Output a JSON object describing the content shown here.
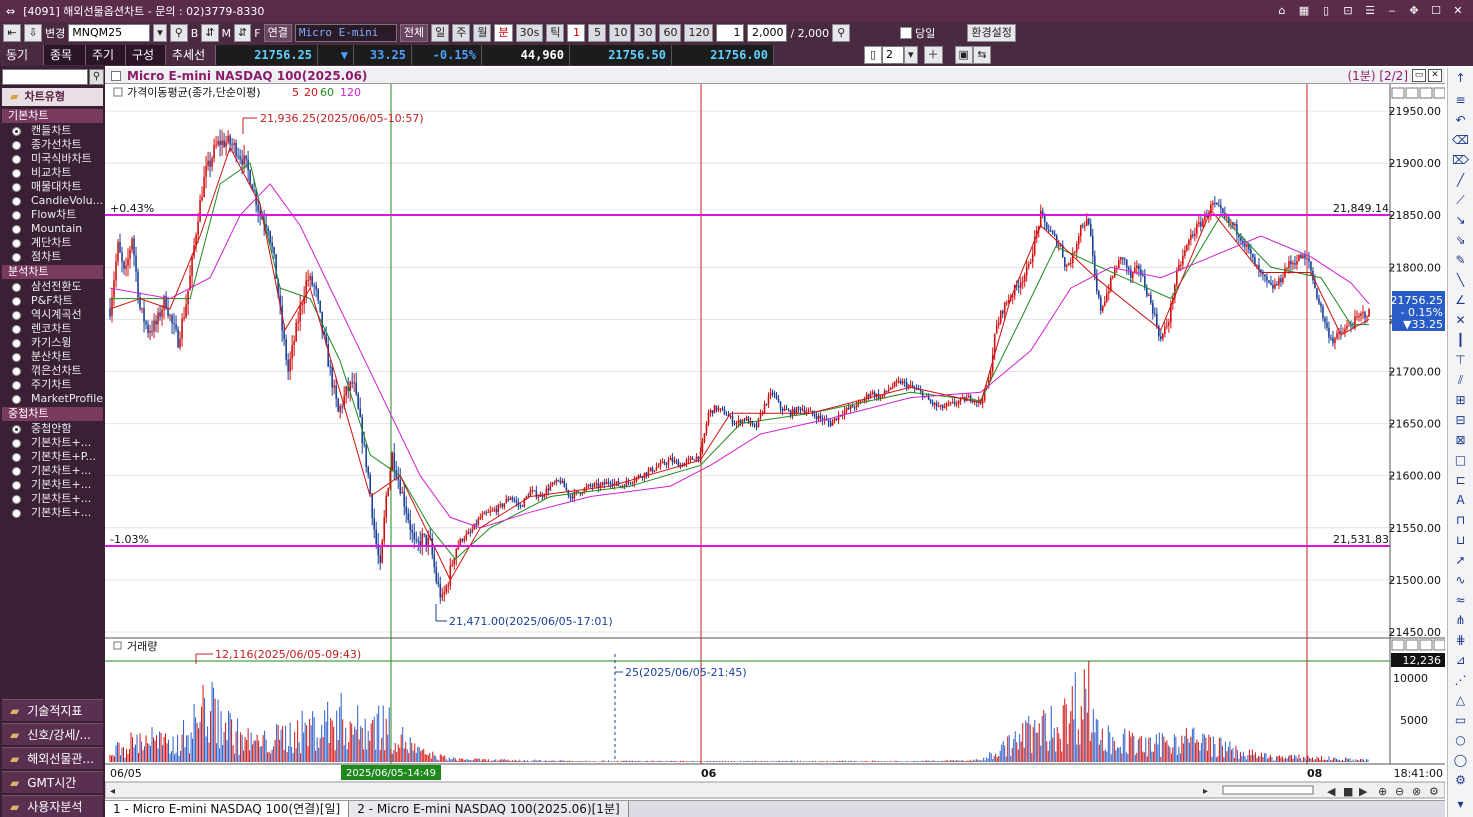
{
  "window": {
    "title": "[4091] 해외선물옵션차트 - 문의 : 02)3779-8330",
    "controls": [
      "⌂",
      "▦",
      "▯",
      "⊡",
      "☰",
      "‒",
      "✥",
      "☐",
      "✕"
    ]
  },
  "toolbar1": {
    "change_label": "변경",
    "symbol_value": "MNQM25",
    "btn_b": "B",
    "btn_m": "M",
    "btn_f": "F",
    "linked_label": "연결",
    "product_name": "Micro E-mini NAS",
    "all_label": "전체",
    "periods": [
      "일",
      "주",
      "월",
      "분",
      "30s",
      "틱"
    ],
    "minutes": [
      "1",
      "5",
      "10",
      "30",
      "60",
      "120"
    ],
    "step_value": "1",
    "count_value": "2,000",
    "count_total": "/ 2,000",
    "today_label": "당일",
    "settings_label": "환경설정"
  },
  "toolbar2": {
    "tabs": [
      "동기화",
      "종목",
      "주기",
      "구성",
      "추세선"
    ],
    "last_price": "21756.25",
    "change_arrow": "▼",
    "change": "33.25",
    "change_pct": "-0.15%",
    "volume": "44,960",
    "ask": "21756.50",
    "bid": "21756.00",
    "split_value": "2"
  },
  "left_panel": {
    "header": "차트유형",
    "sections": [
      {
        "title": "기본차트",
        "items": [
          "캔들차트",
          "종가선차트",
          "미국식바차트",
          "비교차트",
          "매물대차트",
          "CandleVolu...",
          "Flow차트",
          "Mountain",
          "계단차트",
          "점차트"
        ]
      },
      {
        "title": "분석차트",
        "items": [
          "삼선전환도",
          "P&F차트",
          "역시계곡선",
          "렌코차트",
          "카기스윙",
          "분산차트",
          "꺾은선차트",
          "주기차트",
          "MarketProfile"
        ]
      },
      {
        "title": "중첩차트",
        "items": [
          "중첩안함",
          "기본차트+...",
          "기본차트+P...",
          "기본차트+...",
          "기본차트+...",
          "기본차트+...",
          "기본차트+..."
        ]
      }
    ],
    "footer": [
      "기술적지표",
      "신호/강세/...",
      "해외선물관...",
      "GMT시간",
      "사용자분석"
    ]
  },
  "chart": {
    "title": "Micro E-mini NASDAQ 100(2025.06)",
    "period_info": "(1분) [2/2]",
    "ma_label": "가격이동평균(종가,단순이평)",
    "ma_periods": [
      "5",
      "20",
      "60",
      "120"
    ],
    "ma_colors": [
      "#d01010",
      "#1e8a1e",
      "#1a3f9a",
      "#d020d0"
    ],
    "high_label": "21,936.25(2025/06/05-10:57)",
    "low_label": "21,471.00(2025/06/05-17:01)",
    "upper_line": {
      "pct": "+0.43%",
      "value": "21,849.14"
    },
    "lower_line": {
      "pct": "-1.03%",
      "value": "21,531.83"
    },
    "price_ticks": [
      "21950.00",
      "21900.00",
      "21850.00",
      "21800.00",
      "21750.00",
      "21700.00",
      "21650.00",
      "21600.00",
      "21550.00",
      "21500.00",
      "21450.00"
    ],
    "last_box": {
      "price": "21756.25",
      "pct": "- 0.15%",
      "chg": "▼33.25"
    },
    "volume_title": "거래량",
    "volume_high_label": "12,116(2025/06/05-09:43)",
    "volume_low_label": "25(2025/06/05-21:45)",
    "volume_last": "12,236",
    "volume_ticks": [
      "10000",
      "5000"
    ],
    "x_labels": [
      "06/05",
      "06",
      "08",
      "18:41:00"
    ],
    "crosshair_time": "2025/06/05-14:49"
  },
  "chart_data": {
    "type": "candlestick",
    "title": "Micro E-mini NASDAQ 100(2025.06)",
    "interval": "1분",
    "ylim": [
      21440,
      21960
    ],
    "close_path": [
      [
        0,
        21760
      ],
      [
        8,
        21820
      ],
      [
        15,
        21790
      ],
      [
        22,
        21830
      ],
      [
        30,
        21760
      ],
      [
        38,
        21740
      ],
      [
        46,
        21745
      ],
      [
        55,
        21770
      ],
      [
        62,
        21745
      ],
      [
        68,
        21730
      ],
      [
        75,
        21760
      ],
      [
        80,
        21790
      ],
      [
        88,
        21850
      ],
      [
        95,
        21890
      ],
      [
        100,
        21900
      ],
      [
        105,
        21915
      ],
      [
        110,
        21920
      ],
      [
        118,
        21920
      ],
      [
        125,
        21915
      ],
      [
        135,
        21900
      ],
      [
        142,
        21880
      ],
      [
        150,
        21850
      ],
      [
        158,
        21840
      ],
      [
        165,
        21800
      ],
      [
        172,
        21740
      ],
      [
        178,
        21700
      ],
      [
        184,
        21730
      ],
      [
        190,
        21760
      ],
      [
        197,
        21790
      ],
      [
        205,
        21780
      ],
      [
        212,
        21740
      ],
      [
        220,
        21700
      ],
      [
        228,
        21660
      ],
      [
        236,
        21680
      ],
      [
        243,
        21690
      ],
      [
        250,
        21650
      ],
      [
        258,
        21600
      ],
      [
        265,
        21540
      ],
      [
        270,
        21510
      ],
      [
        276,
        21580
      ],
      [
        282,
        21620
      ],
      [
        290,
        21590
      ],
      [
        298,
        21560
      ],
      [
        305,
        21530
      ],
      [
        312,
        21540
      ],
      [
        320,
        21535
      ],
      [
        326,
        21500
      ],
      [
        332,
        21480
      ],
      [
        338,
        21500
      ],
      [
        345,
        21530
      ],
      [
        352,
        21540
      ],
      [
        360,
        21545
      ],
      [
        370,
        21560
      ],
      [
        380,
        21565
      ],
      [
        390,
        21570
      ],
      [
        400,
        21580
      ],
      [
        410,
        21570
      ],
      [
        420,
        21585
      ],
      [
        430,
        21580
      ],
      [
        440,
        21590
      ],
      [
        450,
        21595
      ],
      [
        460,
        21580
      ],
      [
        470,
        21585
      ],
      [
        480,
        21590
      ],
      [
        490,
        21590
      ],
      [
        500,
        21595
      ],
      [
        510,
        21590
      ],
      [
        520,
        21595
      ],
      [
        530,
        21600
      ],
      [
        540,
        21605
      ],
      [
        550,
        21610
      ],
      [
        560,
        21615
      ],
      [
        570,
        21610
      ],
      [
        580,
        21615
      ],
      [
        590,
        21620
      ],
      [
        598,
        21660
      ],
      [
        605,
        21665
      ],
      [
        615,
        21660
      ],
      [
        625,
        21650
      ],
      [
        635,
        21655
      ],
      [
        645,
        21645
      ],
      [
        655,
        21670
      ],
      [
        662,
        21680
      ],
      [
        670,
        21665
      ],
      [
        680,
        21660
      ],
      [
        690,
        21665
      ],
      [
        700,
        21660
      ],
      [
        710,
        21655
      ],
      [
        720,
        21650
      ],
      [
        730,
        21660
      ],
      [
        740,
        21665
      ],
      [
        750,
        21670
      ],
      [
        760,
        21680
      ],
      [
        770,
        21675
      ],
      [
        780,
        21685
      ],
      [
        790,
        21690
      ],
      [
        800,
        21685
      ],
      [
        810,
        21680
      ],
      [
        820,
        21670
      ],
      [
        830,
        21665
      ],
      [
        840,
        21668
      ],
      [
        850,
        21672
      ],
      [
        860,
        21675
      ],
      [
        870,
        21670
      ],
      [
        878,
        21690
      ],
      [
        885,
        21740
      ],
      [
        892,
        21760
      ],
      [
        898,
        21770
      ],
      [
        905,
        21780
      ],
      [
        912,
        21790
      ],
      [
        918,
        21800
      ],
      [
        925,
        21830
      ],
      [
        930,
        21850
      ],
      [
        935,
        21840
      ],
      [
        942,
        21830
      ],
      [
        950,
        21820
      ],
      [
        955,
        21800
      ],
      [
        962,
        21810
      ],
      [
        970,
        21840
      ],
      [
        978,
        21845
      ],
      [
        985,
        21780
      ],
      [
        990,
        21760
      ],
      [
        998,
        21780
      ],
      [
        1005,
        21800
      ],
      [
        1012,
        21810
      ],
      [
        1020,
        21790
      ],
      [
        1028,
        21800
      ],
      [
        1035,
        21780
      ],
      [
        1042,
        21760
      ],
      [
        1050,
        21730
      ],
      [
        1058,
        21750
      ],
      [
        1065,
        21790
      ],
      [
        1072,
        21810
      ],
      [
        1080,
        21830
      ],
      [
        1088,
        21840
      ],
      [
        1095,
        21850
      ],
      [
        1102,
        21860
      ],
      [
        1108,
        21855
      ],
      [
        1115,
        21845
      ],
      [
        1122,
        21840
      ],
      [
        1130,
        21830
      ],
      [
        1138,
        21815
      ],
      [
        1145,
        21800
      ],
      [
        1152,
        21790
      ],
      [
        1160,
        21780
      ],
      [
        1168,
        21785
      ],
      [
        1175,
        21800
      ],
      [
        1182,
        21805
      ],
      [
        1190,
        21810
      ],
      [
        1198,
        21805
      ],
      [
        1204,
        21780
      ],
      [
        1210,
        21760
      ],
      [
        1216,
        21740
      ],
      [
        1222,
        21730
      ],
      [
        1228,
        21735
      ],
      [
        1234,
        21740
      ],
      [
        1240,
        21745
      ],
      [
        1246,
        21750
      ],
      [
        1252,
        21755
      ],
      [
        1258,
        21756
      ]
    ],
    "ma5": [
      [
        0,
        21760
      ],
      [
        30,
        21770
      ],
      [
        60,
        21760
      ],
      [
        90,
        21830
      ],
      [
        120,
        21915
      ],
      [
        150,
        21860
      ],
      [
        175,
        21740
      ],
      [
        200,
        21780
      ],
      [
        230,
        21680
      ],
      [
        260,
        21580
      ],
      [
        290,
        21600
      ],
      [
        320,
        21540
      ],
      [
        340,
        21500
      ],
      [
        370,
        21550
      ],
      [
        420,
        21580
      ],
      [
        500,
        21590
      ],
      [
        590,
        21615
      ],
      [
        620,
        21660
      ],
      [
        700,
        21660
      ],
      [
        800,
        21685
      ],
      [
        870,
        21670
      ],
      [
        900,
        21770
      ],
      [
        930,
        21840
      ],
      [
        985,
        21790
      ],
      [
        1050,
        21740
      ],
      [
        1100,
        21855
      ],
      [
        1150,
        21795
      ],
      [
        1200,
        21795
      ],
      [
        1230,
        21735
      ],
      [
        1258,
        21750
      ]
    ],
    "ma20": [
      [
        0,
        21770
      ],
      [
        40,
        21770
      ],
      [
        80,
        21770
      ],
      [
        110,
        21880
      ],
      [
        140,
        21900
      ],
      [
        170,
        21780
      ],
      [
        200,
        21770
      ],
      [
        230,
        21710
      ],
      [
        260,
        21620
      ],
      [
        290,
        21600
      ],
      [
        320,
        21550
      ],
      [
        345,
        21520
      ],
      [
        380,
        21550
      ],
      [
        440,
        21580
      ],
      [
        520,
        21590
      ],
      [
        590,
        21610
      ],
      [
        630,
        21650
      ],
      [
        700,
        21660
      ],
      [
        800,
        21680
      ],
      [
        870,
        21672
      ],
      [
        910,
        21750
      ],
      [
        945,
        21820
      ],
      [
        990,
        21800
      ],
      [
        1060,
        21770
      ],
      [
        1110,
        21850
      ],
      [
        1160,
        21800
      ],
      [
        1210,
        21790
      ],
      [
        1240,
        21745
      ],
      [
        1258,
        21745
      ]
    ],
    "ma120": [
      [
        0,
        21780
      ],
      [
        60,
        21770
      ],
      [
        100,
        21790
      ],
      [
        130,
        21850
      ],
      [
        160,
        21880
      ],
      [
        190,
        21840
      ],
      [
        220,
        21780
      ],
      [
        250,
        21720
      ],
      [
        280,
        21660
      ],
      [
        310,
        21600
      ],
      [
        340,
        21560
      ],
      [
        370,
        21550
      ],
      [
        420,
        21565
      ],
      [
        480,
        21580
      ],
      [
        560,
        21590
      ],
      [
        600,
        21610
      ],
      [
        650,
        21640
      ],
      [
        720,
        21655
      ],
      [
        800,
        21675
      ],
      [
        870,
        21680
      ],
      [
        920,
        21720
      ],
      [
        960,
        21780
      ],
      [
        1000,
        21800
      ],
      [
        1050,
        21790
      ],
      [
        1100,
        21810
      ],
      [
        1150,
        21830
      ],
      [
        1200,
        21810
      ],
      [
        1240,
        21785
      ],
      [
        1258,
        21765
      ]
    ],
    "volume_path": [
      [
        0,
        1500
      ],
      [
        20,
        3000
      ],
      [
        40,
        4000
      ],
      [
        60,
        2500
      ],
      [
        80,
        5000
      ],
      [
        95,
        9000
      ],
      [
        110,
        7000
      ],
      [
        130,
        4000
      ],
      [
        150,
        3000
      ],
      [
        170,
        4000
      ],
      [
        190,
        5000
      ],
      [
        210,
        6000
      ],
      [
        230,
        7000
      ],
      [
        250,
        5500
      ],
      [
        270,
        6500
      ],
      [
        290,
        4000
      ],
      [
        310,
        1500
      ],
      [
        340,
        500
      ],
      [
        380,
        300
      ],
      [
        450,
        200
      ],
      [
        520,
        150
      ],
      [
        600,
        100
      ],
      [
        700,
        150
      ],
      [
        800,
        120
      ],
      [
        870,
        300
      ],
      [
        890,
        2000
      ],
      [
        920,
        5000
      ],
      [
        950,
        6000
      ],
      [
        975,
        12000
      ],
      [
        990,
        4000
      ],
      [
        1010,
        3500
      ],
      [
        1040,
        2500
      ],
      [
        1070,
        4000
      ],
      [
        1100,
        3000
      ],
      [
        1130,
        1500
      ],
      [
        1160,
        800
      ],
      [
        1200,
        700
      ],
      [
        1240,
        400
      ],
      [
        1258,
        300
      ]
    ],
    "vol_ylim": [
      0,
      12500
    ]
  }
}
